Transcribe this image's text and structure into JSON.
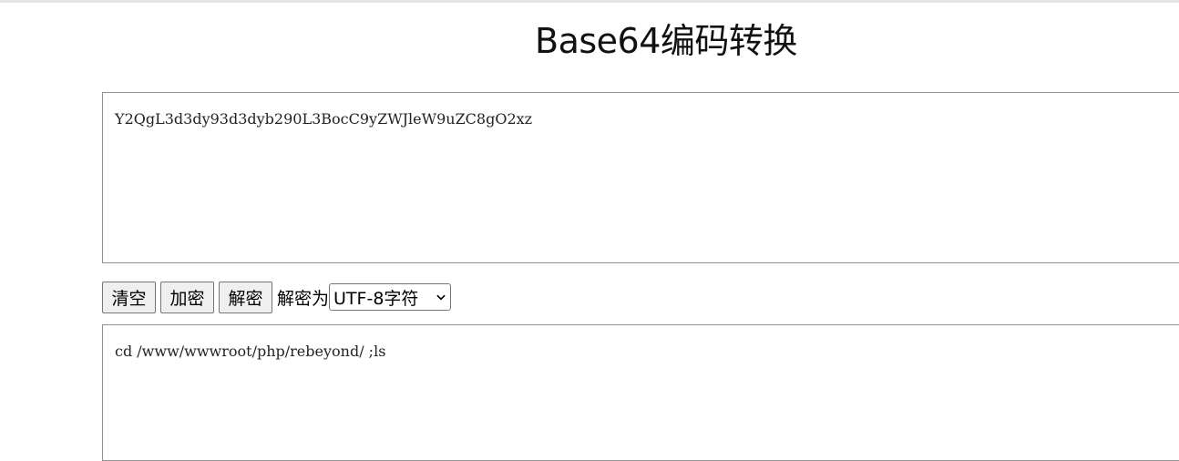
{
  "header": {
    "title": "Base64编码转换"
  },
  "input": {
    "value": "Y2QgL3d3dy93d3dyb290L3BocC9yZWJleW9uZC8gO2xz"
  },
  "controls": {
    "clear_label": "清空",
    "encode_label": "加密",
    "decode_label": "解密",
    "decode_as_label": "解密为",
    "charset_selected": "UTF-8字符"
  },
  "output": {
    "value": "cd /www/wwwroot/php/rebeyond/ ;ls"
  },
  "icons": {
    "select_arrow": "chevron-down-icon"
  }
}
